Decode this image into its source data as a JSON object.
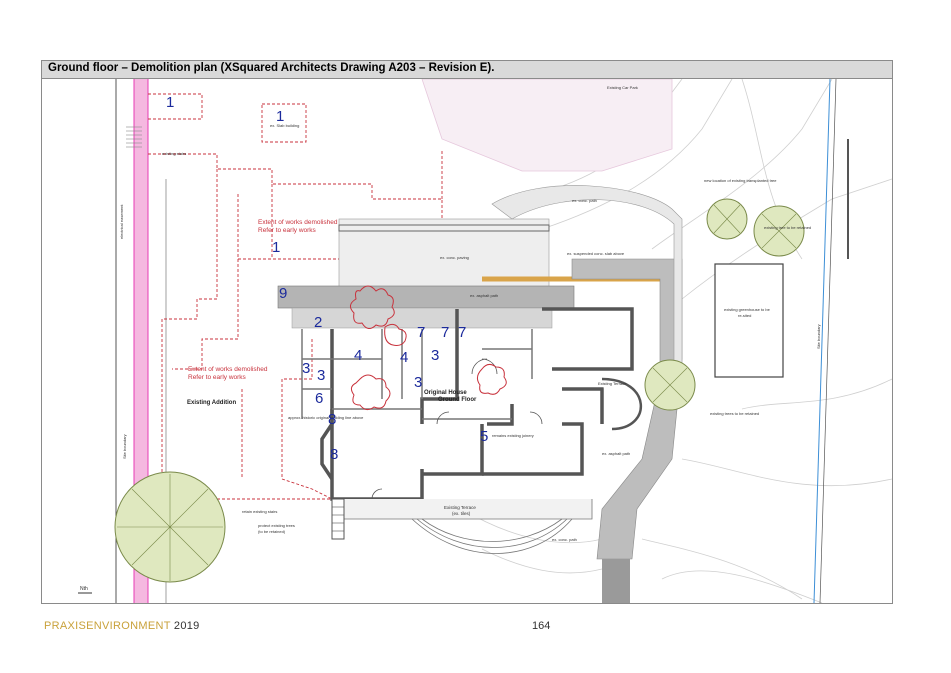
{
  "document": {
    "title": "Ground floor – Demolition plan (XSquared Architects Drawing A203 – Revision E).",
    "footer": {
      "brand_part1": "PRAXIS",
      "brand_part2": "ENVIRONMENT",
      "year": "2019",
      "page_number": "164"
    }
  },
  "plan": {
    "labels": {
      "car_park": "Existing Car Park",
      "slab_building": "ex. Slab building",
      "existing_stairs": "existing stairs",
      "electrical_easement": "electrical easement",
      "site_boundary": "Site boundary",
      "demolished_1_line1": "Extent of works demolished",
      "demolished_1_line2": "Refer to early works",
      "demolished_2_line1": "Extent of works demolished",
      "demolished_2_line2": "Refer to early works",
      "existing_addition": "Existing Addition",
      "original_house_line1": "Original House",
      "original_house_line2": "Ground Floor",
      "existing_terrace": "Existing Terrace",
      "existing_terrace_sub": "(ex. tiles)",
      "existing_terrace_right": "Existing Terrace",
      "conc_path_top": "ex. conc. path",
      "conc_path_bottom": "ex. conc. path",
      "conc_paving": "ex. conc. paving",
      "asphalt_path": "ex. asphalt path",
      "asphalt_path_side": "ex. asphalt path",
      "suspended_slab": "ex. suspended conc. slab above",
      "remains_existing_joinery": "remains existing joinery",
      "existing_trees_retained": "existing trees to be retained",
      "new_location_trees": "new location of existing transplanted tree",
      "existing_tree_retained": "existing tree to be retained",
      "greenhouse_line1": "existing greenhouse to be",
      "greenhouse_line2": "re-sited",
      "protect_trees_line1": "protect existing trees",
      "protect_trees_line2": "(to be retained)",
      "retain_stairs": "retain existing stairs",
      "approx_original": "approx. historic original building line above",
      "north_marker": "Nth"
    },
    "numbers": [
      {
        "id": "n1a",
        "text": "1"
      },
      {
        "id": "n1b",
        "text": "1"
      },
      {
        "id": "n1c",
        "text": "1"
      },
      {
        "id": "n9",
        "text": "9"
      },
      {
        "id": "n2",
        "text": "2"
      },
      {
        "id": "n7a",
        "text": "7"
      },
      {
        "id": "n7b",
        "text": "7"
      },
      {
        "id": "n7c",
        "text": "7"
      },
      {
        "id": "n4a",
        "text": "4"
      },
      {
        "id": "n4b",
        "text": "4"
      },
      {
        "id": "n3a",
        "text": "3"
      },
      {
        "id": "n3b",
        "text": "3"
      },
      {
        "id": "n3c",
        "text": "3"
      },
      {
        "id": "n3d",
        "text": "3"
      },
      {
        "id": "n6",
        "text": "6"
      },
      {
        "id": "n8a",
        "text": "8"
      },
      {
        "id": "n8b",
        "text": "8"
      },
      {
        "id": "n5",
        "text": "5"
      }
    ],
    "colors": {
      "demolition_red": "#c8323c",
      "site_pink": "#f5b8e0",
      "site_magenta": "#e63cb4",
      "car_park_fill": "#f7eef4",
      "paving_grey": "#b4b4b4",
      "terrace_orange": "#d9a44a",
      "wall_dark": "#555555",
      "tree_green": "#dfe8bf",
      "tree_outline": "#7a8a4a",
      "number_blue": "#1b2a9c",
      "water_blue": "#3d8fd6"
    }
  }
}
